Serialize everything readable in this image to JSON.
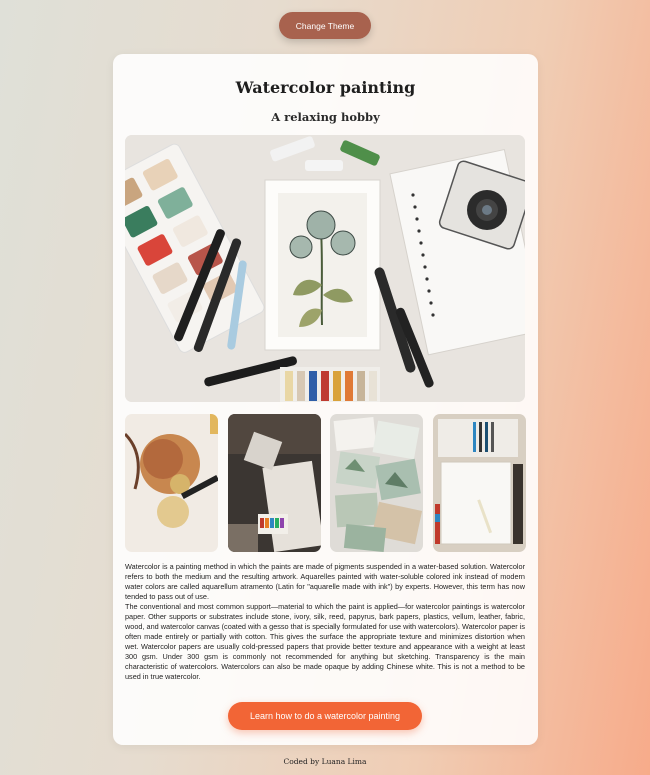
{
  "header": {
    "theme_button_label": "Change Theme"
  },
  "card": {
    "title": "Watercolor painting",
    "subtitle": "A relaxing hobby",
    "paragraphs": [
      "Watercolor is a painting method in which the paints are made of pigments suspended in a water-based solution. Watercolor refers to both the medium and the resulting artwork. Aquarelles painted with water-soluble colored ink instead of modern water colors are called aquarellum atramento (Latin for \"aquarelle made with ink\") by experts. However, this term has now tended to pass out of use.",
      "The conventional and most common support—material to which the paint is applied—for watercolor paintings is watercolor paper. Other supports or substrates include stone, ivory, silk, reed, papyrus, bark papers, plastics, vellum, leather, fabric, wood, and watercolor canvas (coated with a gesso that is specially formulated for use with watercolors). Watercolor paper is often made entirely or partially with cotton. This gives the surface the appropriate texture and minimizes distortion when wet. Watercolor papers are usually cold-pressed papers that provide better texture and appearance with a weight at least 300 gsm. Under 300 gsm is commonly not recommended for anything but sketching. Transparency is the main characteristic of watercolors. Watercolors can also be made opaque by adding Chinese white. This is not a method to be used in true watercolor."
    ],
    "cta_label": "Learn how to do a watercolor painting"
  },
  "footer": {
    "credit": "Coded by Luana Lima"
  },
  "colors": {
    "theme_button": "#a8624e",
    "cta_button": "#f26536",
    "card_background": "#fdfbf9"
  }
}
